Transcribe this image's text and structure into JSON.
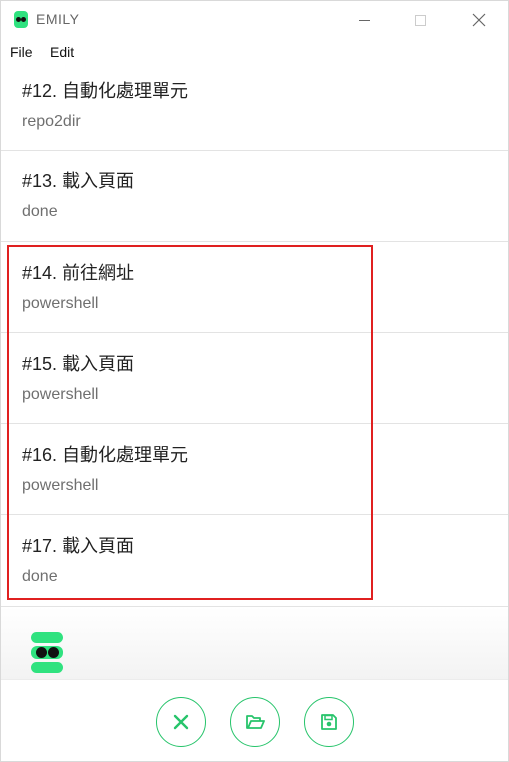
{
  "window": {
    "title": "EMILY"
  },
  "menu": {
    "file": "File",
    "edit": "Edit"
  },
  "items": [
    {
      "title": "#12. 自動化處理單元",
      "subtitle": "repo2dir"
    },
    {
      "title": "#13. 載入頁面",
      "subtitle": "done"
    },
    {
      "title": "#14. 前往網址",
      "subtitle": "powershell"
    },
    {
      "title": "#15. 載入頁面",
      "subtitle": "powershell"
    },
    {
      "title": "#16. 自動化處理單元",
      "subtitle": "powershell"
    },
    {
      "title": "#17. 載入頁面",
      "subtitle": "done"
    }
  ],
  "colors": {
    "accent": "#27c46b",
    "brand": "#2fe27f",
    "highlight": "#e02020"
  },
  "icons": {
    "cancel": "close-icon",
    "open": "folder-open-icon",
    "save": "save-icon"
  }
}
